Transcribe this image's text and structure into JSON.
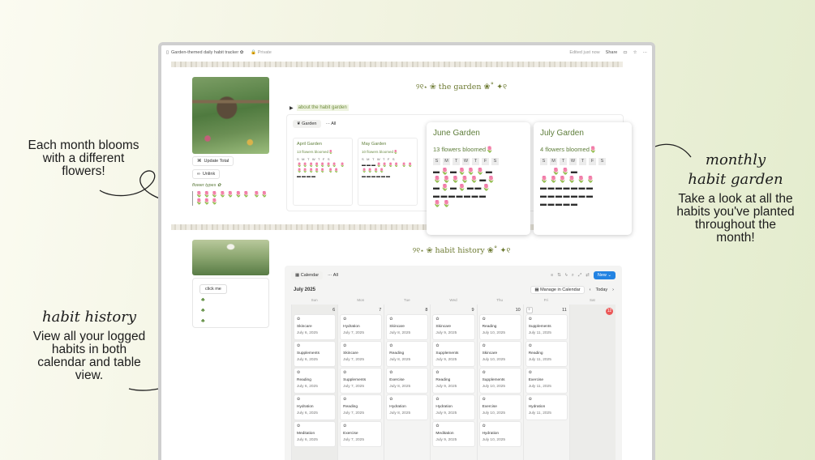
{
  "annotations": {
    "left_top": "Each month blooms with a different flowers!",
    "left_bottom_title": "habit history",
    "left_bottom_text": "View all your logged habits in both calendar and table view.",
    "right_title_1": "monthly",
    "right_title_2": "habit garden",
    "right_text": "Take a look at all the habits you've planted throughout the month!"
  },
  "topbar": {
    "title": "Garden-themed daily habit tracker ✿",
    "privacy": "Private",
    "edited": "Edited just now",
    "share": "Share"
  },
  "sidebar": {
    "update_total": "Update Total",
    "unlink": "Unlink",
    "flower_types": "flower types ✿",
    "flower_icons": "🌷🌷🌷🌷🌷🌷🌷 🌷🌷🌷🌷🌷",
    "click_me": "click me"
  },
  "garden": {
    "title": "୨୧⋆ ❀ the garden ❀˚ ✦୧",
    "toggle": "about the habit garden",
    "tab_garden": "Garden",
    "tab_all": "All",
    "cards": [
      {
        "title": "April Garden",
        "sub": "13 flowers bloomed🌷",
        "days": "S M T W T F S"
      },
      {
        "title": "May Garden",
        "sub": "10 flowers bloomed🌷",
        "days": "S M T W T F S"
      },
      {
        "title": "June Garden",
        "sub": "13 flowers bloomed🌷",
        "days": [
          "S",
          "M",
          "T",
          "W",
          "T",
          "F",
          "S"
        ]
      },
      {
        "title": "July Garden",
        "sub": "4 flowers bloomed🌷",
        "days": [
          "S",
          "M",
          "T",
          "W",
          "T",
          "F",
          "S"
        ]
      }
    ]
  },
  "history": {
    "title": "୨୧⋆ ❀ habit history ❀˚ ✦୧",
    "view_calendar": "Calendar",
    "view_all": "All",
    "new": "New",
    "month": "July 2025",
    "manage": "Manage in Calendar",
    "today": "Today",
    "weekdays": [
      "Sun",
      "Mon",
      "Tue",
      "Wed",
      "Thu",
      "Fri",
      "Sat"
    ],
    "days": [
      "6",
      "7",
      "8",
      "9",
      "10",
      "11",
      "12"
    ],
    "columns": [
      [
        {
          "n": "Skincare",
          "d": "July 6, 2025"
        },
        {
          "n": "Supplements",
          "d": "July 6, 2025"
        },
        {
          "n": "Reading",
          "d": "July 6, 2025"
        },
        {
          "n": "Hydration",
          "d": "July 6, 2025"
        },
        {
          "n": "Meditation",
          "d": "July 6, 2025"
        }
      ],
      [
        {
          "n": "Hydration",
          "d": "July 7, 2025"
        },
        {
          "n": "Skincare",
          "d": "July 7, 2025"
        },
        {
          "n": "Supplements",
          "d": "July 7, 2025"
        },
        {
          "n": "Reading",
          "d": "July 7, 2025"
        },
        {
          "n": "Exercise",
          "d": "July 7, 2025"
        }
      ],
      [
        {
          "n": "Skincare",
          "d": "July 8, 2025"
        },
        {
          "n": "Reading",
          "d": "July 8, 2025"
        },
        {
          "n": "Exercise",
          "d": "July 8, 2025"
        },
        {
          "n": "Hydration",
          "d": "July 8, 2025"
        }
      ],
      [
        {
          "n": "Skincare",
          "d": "July 9, 2025"
        },
        {
          "n": "Supplements",
          "d": "July 9, 2025"
        },
        {
          "n": "Reading",
          "d": "July 9, 2025"
        },
        {
          "n": "Hydration",
          "d": "July 9, 2025"
        },
        {
          "n": "Meditation",
          "d": "July 9, 2025"
        }
      ],
      [
        {
          "n": "Reading",
          "d": "July 10, 2025"
        },
        {
          "n": "Skincare",
          "d": "July 10, 2025"
        },
        {
          "n": "Supplements",
          "d": "July 10, 2025"
        },
        {
          "n": "Exercise",
          "d": "July 10, 2025"
        },
        {
          "n": "Hydration",
          "d": "July 10, 2025"
        }
      ],
      [
        {
          "n": "Supplements",
          "d": "July 11, 2025"
        },
        {
          "n": "Reading",
          "d": "July 11, 2025"
        },
        {
          "n": "Exercise",
          "d": "July 11, 2025"
        },
        {
          "n": "Hydration",
          "d": "July 11, 2025"
        }
      ],
      []
    ]
  }
}
